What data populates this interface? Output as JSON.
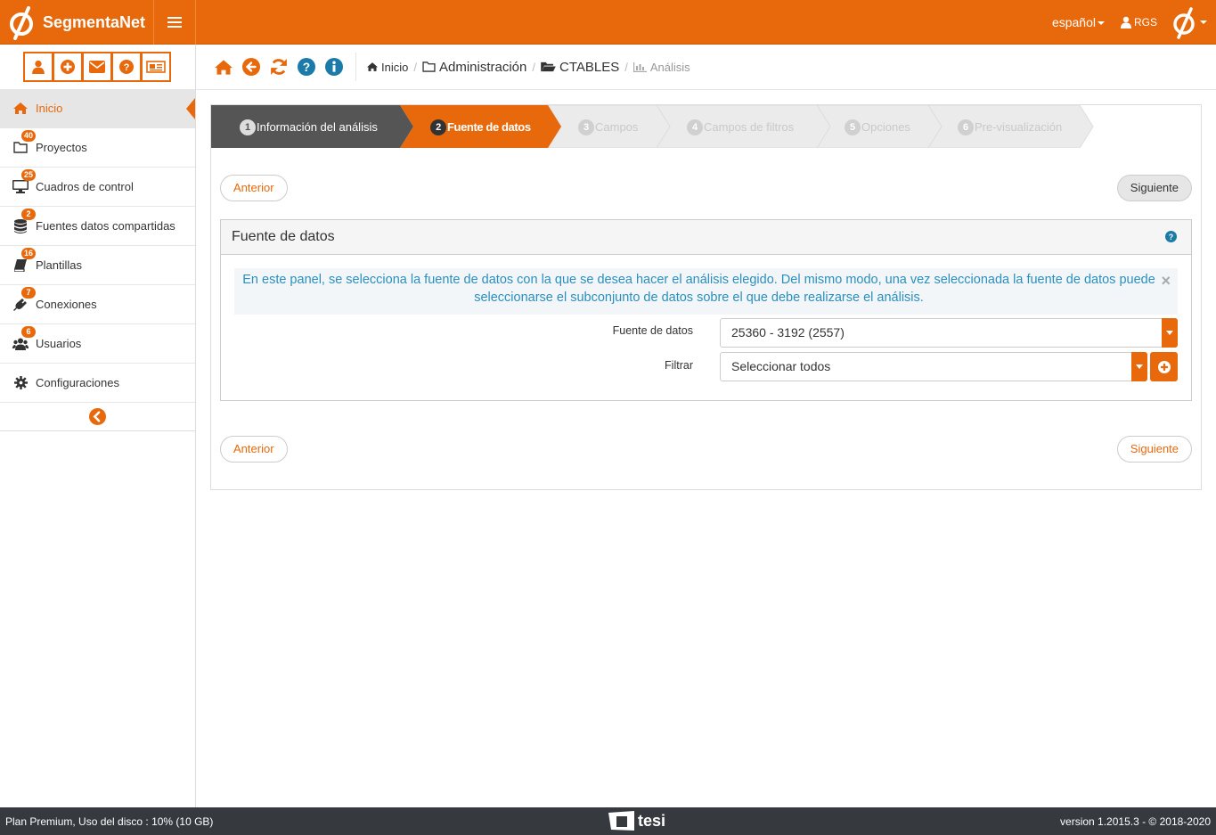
{
  "app": {
    "brand": "SegmentaNet"
  },
  "topbar": {
    "language": "español",
    "user": "RGS"
  },
  "sidebar": {
    "quick_actions": [
      "user-icon",
      "plus-circle-icon",
      "envelope-icon",
      "question-icon",
      "newspaper-icon"
    ],
    "items": [
      {
        "label": "Inicio",
        "badge": ""
      },
      {
        "label": "Proyectos",
        "badge": "40"
      },
      {
        "label": "Cuadros de control",
        "badge": "25"
      },
      {
        "label": "Fuentes datos compartidas",
        "badge": "2"
      },
      {
        "label": "Plantillas",
        "badge": "16"
      },
      {
        "label": "Conexiones",
        "badge": "7"
      },
      {
        "label": "Usuarios",
        "badge": "6"
      },
      {
        "label": "Configuraciones",
        "badge": ""
      }
    ]
  },
  "breadcrumb": {
    "home": "Inicio",
    "admin": "Administración",
    "folder": "CTABLES",
    "current": "Análisis"
  },
  "wizard": {
    "steps": [
      {
        "num": "1",
        "label": "Información del análisis",
        "state": "done"
      },
      {
        "num": "2",
        "label": "Fuente de datos",
        "state": "active"
      },
      {
        "num": "3",
        "label": "Campos",
        "state": "pending"
      },
      {
        "num": "4",
        "label": "Campos de filtros",
        "state": "pending"
      },
      {
        "num": "5",
        "label": "Opciones",
        "state": "pending"
      },
      {
        "num": "6",
        "label": "Pre-visualización",
        "state": "pending"
      }
    ],
    "prev_label": "Anterior",
    "next_label": "Siguiente"
  },
  "panel": {
    "title": "Fuente de datos",
    "info": "En este panel, se selecciona la fuente de datos con la que se desea hacer el análisis elegido. Del mismo modo, una vez seleccionada la fuente de datos puede seleccionarse el subconjunto de datos sobre el que debe realizarse el análisis.",
    "datasource_label": "Fuente de datos",
    "datasource_value": "25360 - 3192 (2557)",
    "filter_label": "Filtrar",
    "filter_value": "Seleccionar todos"
  },
  "footer": {
    "plan": "Plan Premium, Uso del disco : 10% (10 GB)",
    "company": "tesi",
    "version": "version 1.2015.3 - © 2018-2020"
  },
  "colors": {
    "accent": "#e8690b",
    "dark": "#36393e",
    "info": "#2a8fbd"
  }
}
